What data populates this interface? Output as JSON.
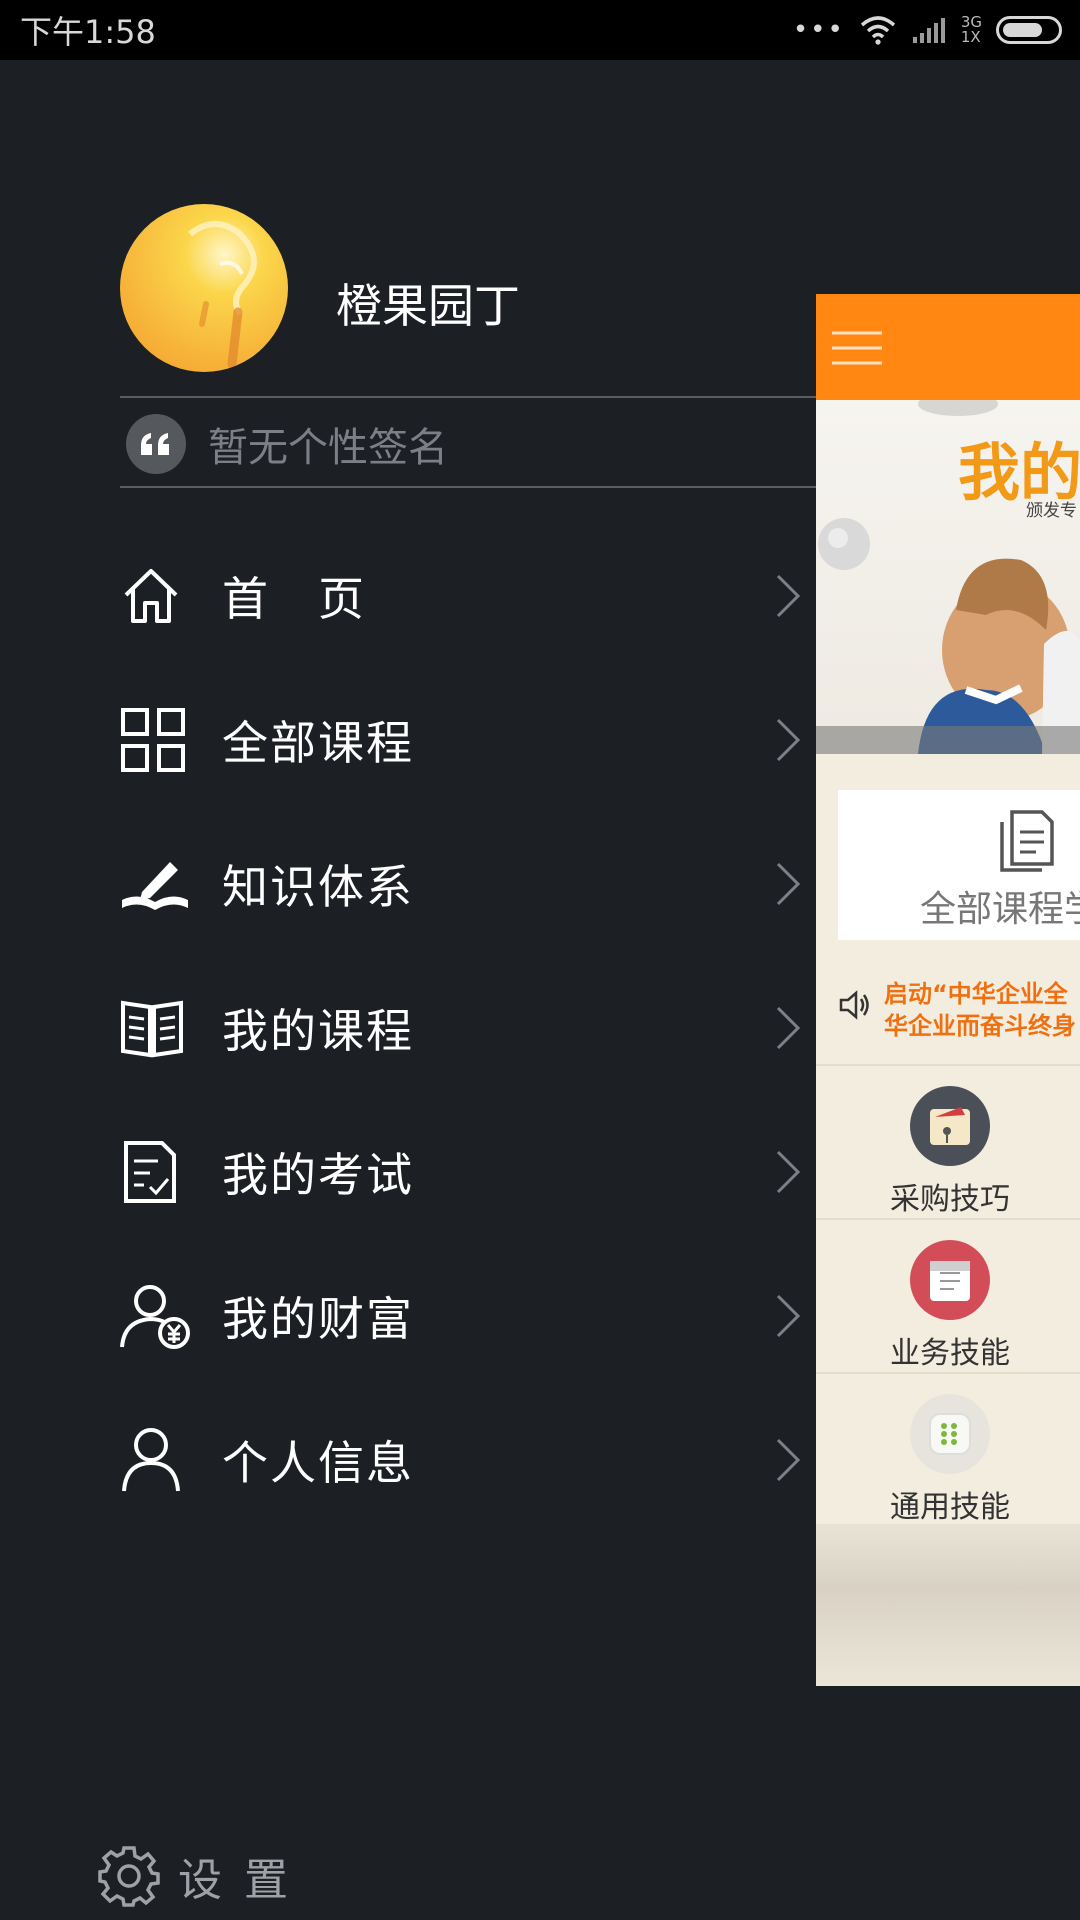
{
  "status_bar": {
    "time": "下午1:58",
    "dots": "•••",
    "network_line1": "3G",
    "network_line2": "1X",
    "battery_level": 0.75
  },
  "profile": {
    "username": "橙果园丁",
    "signature_placeholder": "暂无个性签名"
  },
  "menu": [
    {
      "label": "首　页",
      "icon": "home-icon"
    },
    {
      "label": "全部课程",
      "icon": "grid-icon"
    },
    {
      "label": "知识体系",
      "icon": "book-pen-icon"
    },
    {
      "label": "我的课程",
      "icon": "open-book-icon"
    },
    {
      "label": "我的考试",
      "icon": "exam-checklist-icon"
    },
    {
      "label": "我的财富",
      "icon": "user-yen-icon"
    },
    {
      "label": "个人信息",
      "icon": "user-icon"
    }
  ],
  "settings": {
    "label": "设置",
    "icon": "gear-icon"
  },
  "main_peek": {
    "accent_color": "#ff8712",
    "banner_title": "我的",
    "banner_subtitle": "颁发专",
    "all_courses_card": "全部课程学",
    "notice_line1": "启动“中华企业全",
    "notice_line2": "华企业而奋斗终身",
    "categories": [
      {
        "label": "采购技巧",
        "icon": "shopping-bag-icon",
        "color": "#4a4f58"
      },
      {
        "label": "业务技能",
        "icon": "calendar-icon",
        "color": "#d24d57"
      },
      {
        "label": "通用技能",
        "icon": "app-icon",
        "color": "#e6e4dc"
      }
    ]
  }
}
